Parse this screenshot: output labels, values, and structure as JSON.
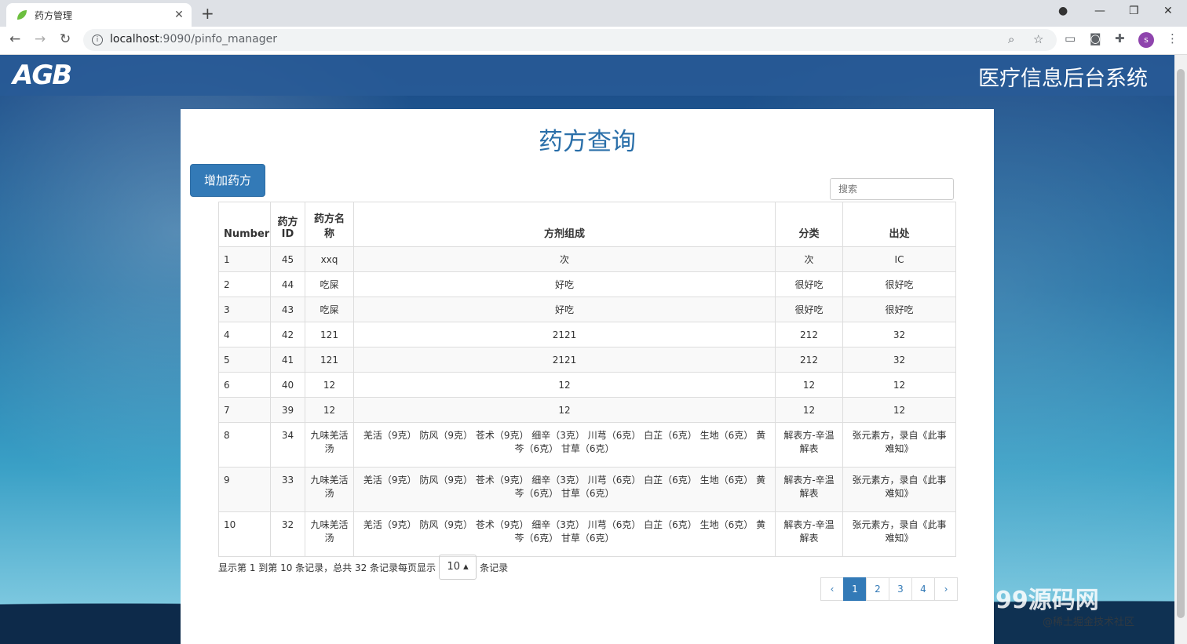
{
  "browser": {
    "tab_title": "药方管理",
    "url_host": "localhost",
    "url_path": ":9090/pinfo_manager"
  },
  "header": {
    "logo": "AGB",
    "system_title": "医疗信息后台系统"
  },
  "page": {
    "title": "药方查询",
    "add_button": "增加药方",
    "search_placeholder": "搜索"
  },
  "table": {
    "columns": [
      "Number",
      "药方ID",
      "药方名称",
      "方剂组成",
      "分类",
      "出处"
    ],
    "rows": [
      [
        "1",
        "45",
        "xxq",
        "次",
        "次",
        "IC"
      ],
      [
        "2",
        "44",
        "吃屎",
        "好吃",
        "很好吃",
        "很好吃"
      ],
      [
        "3",
        "43",
        "吃屎",
        "好吃",
        "很好吃",
        "很好吃"
      ],
      [
        "4",
        "42",
        "121",
        "2121",
        "212",
        "32"
      ],
      [
        "5",
        "41",
        "121",
        "2121",
        "212",
        "32"
      ],
      [
        "6",
        "40",
        "12",
        "12",
        "12",
        "12"
      ],
      [
        "7",
        "39",
        "12",
        "12",
        "12",
        "12"
      ],
      [
        "8",
        "34",
        "九味羌活汤",
        "羌活（9克） 防风（9克） 苍术（9克） 细辛（3克） 川芎（6克） 白芷（6克） 生地（6克） 黄芩（6克） 甘草（6克）",
        "解表方-辛温解表",
        "张元素方，录自《此事难知》"
      ],
      [
        "9",
        "33",
        "九味羌活汤",
        "羌活（9克） 防风（9克） 苍术（9克） 细辛（3克） 川芎（6克） 白芷（6克） 生地（6克） 黄芩（6克） 甘草（6克）",
        "解表方-辛温解表",
        "张元素方，录自《此事难知》"
      ],
      [
        "10",
        "32",
        "九味羌活汤",
        "羌活（9克） 防风（9克） 苍术（9克） 细辛（3克） 川芎（6克） 白芷（6克） 生地（6克） 黄芩（6克） 甘草（6克）",
        "解表方-辛温解表",
        "张元素方，录自《此事难知》"
      ]
    ]
  },
  "footer": {
    "info": "显示第 1 到第 10 条记录，总共 32 条记录每页显示",
    "page_size": "10",
    "suffix": "条记录"
  },
  "pagination": {
    "prev": "‹",
    "pages": [
      "1",
      "2",
      "3",
      "4"
    ],
    "active": "1",
    "next": "›"
  },
  "watermark": {
    "main": "99源码网",
    "sub": "@稀土掘金技术社区"
  }
}
